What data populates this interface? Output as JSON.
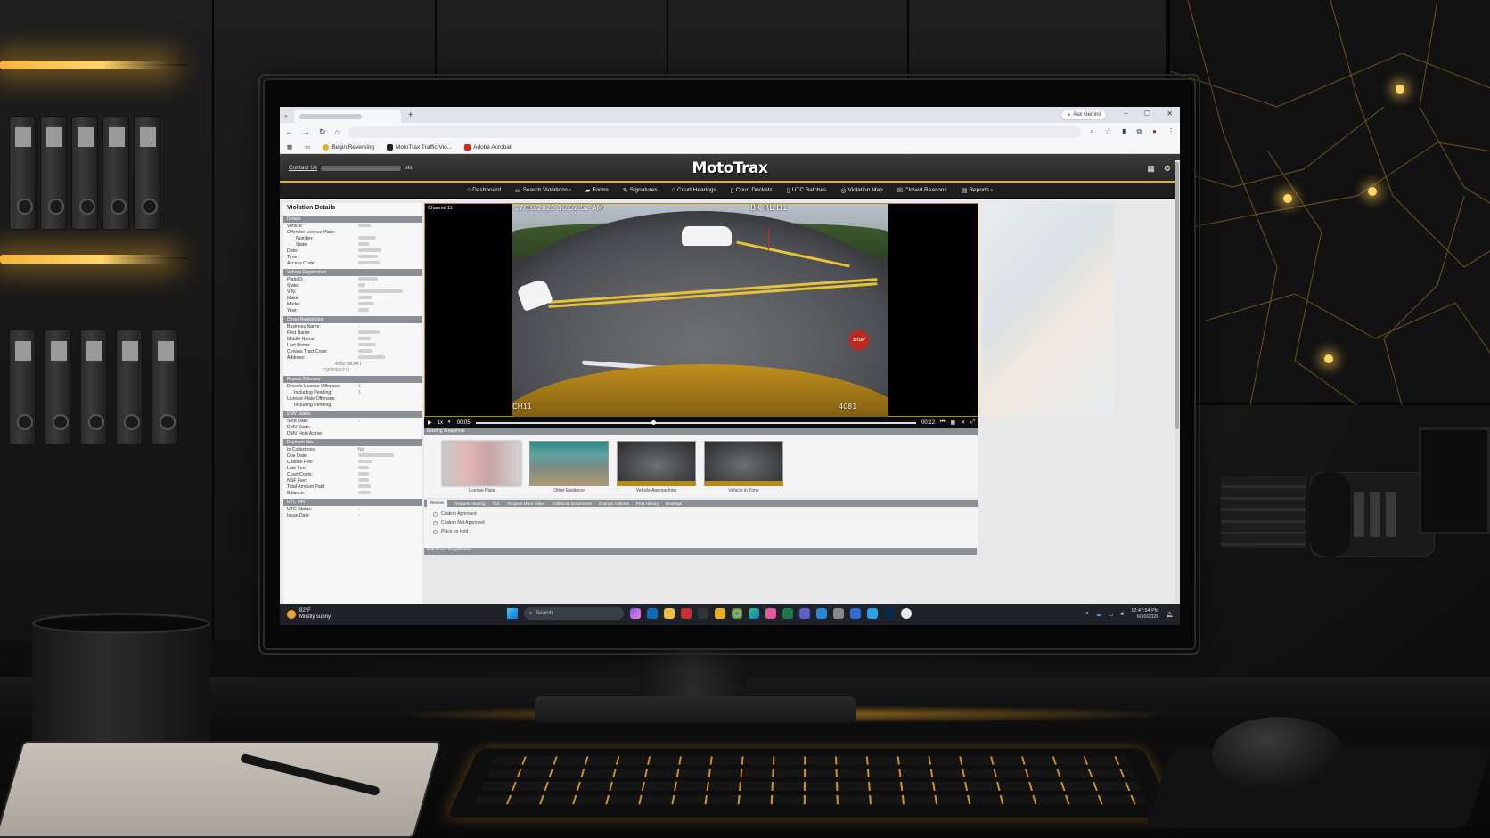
{
  "browser": {
    "new_tab_label": "+",
    "gemini_label": "Ask Gemini",
    "bookmarks": [
      {
        "label": "Begin Reversing",
        "color": "#e8b020"
      },
      {
        "label": "MotoTrax Traffic Vio...",
        "color": "#222222"
      },
      {
        "label": "Adobe Acrobat",
        "color": "#d4281f"
      }
    ]
  },
  "app": {
    "contact_label": "Contact Us",
    "contact_suffix": "ols",
    "logo": "MotoTrax",
    "accent_color": "#e3ad1f",
    "nav": [
      {
        "label": "Dashboard",
        "icon": "home-icon"
      },
      {
        "label": "Search Violations ›",
        "icon": "search-icon"
      },
      {
        "label": "Forms",
        "icon": "folder-icon"
      },
      {
        "label": "Signatures",
        "icon": "signature-icon"
      },
      {
        "label": "Court Hearings",
        "icon": "court-icon"
      },
      {
        "label": "Court Dockets",
        "icon": "docket-icon"
      },
      {
        "label": "UTC Batches",
        "icon": "batch-icon"
      },
      {
        "label": "Violation Map",
        "icon": "map-icon"
      },
      {
        "label": "Closed Reasons",
        "icon": "close-box-icon"
      },
      {
        "label": "Reports ›",
        "icon": "report-icon"
      }
    ]
  },
  "details": {
    "title": "Violation Details",
    "sections": [
      {
        "header": "Details",
        "rows": [
          "Vehicle:",
          "Offender License Plate:",
          "Number:",
          "State:",
          "Date:",
          "Time:",
          "Access Code:"
        ]
      },
      {
        "header": "Vehicle Registration",
        "rows": [
          "PlateID:",
          "State:",
          "VIN:",
          "Make:",
          "Model:",
          "Year:"
        ]
      },
      {
        "header": "Driver Registration",
        "rows": [
          "Business Name:",
          "First Name:",
          "Middle Name:",
          "Last Name:",
          "Census Tract Code:",
          "Address:"
        ]
      },
      {
        "header": "Repeat Offenses",
        "rows": [
          "Driver's License Offenses:",
          "Including Pending:",
          "License Plate Offenses:",
          "Including Pending:"
        ]
      },
      {
        "header": "DMV Status",
        "rows": [
          "Sent Date:",
          "DMV State:",
          "DMV Hold Active:"
        ]
      },
      {
        "header": "Payment Info",
        "rows": [
          "In Collections:",
          "Due Date:",
          "Citation Fee:",
          "Late Fee:",
          "Court Costs:",
          "NSF Fee:",
          "Total Amount Paid:",
          "Balance:"
        ]
      },
      {
        "header": "UTC Info",
        "rows": [
          "UTC Status:",
          "Issue Date:"
        ]
      }
    ],
    "repeat_values": [
      "1",
      "1"
    ],
    "collections_value": "No",
    "address_line1": "4950 INDIA I",
    "address_line2": "FORREST H"
  },
  "video": {
    "channel_label": "Channel 11",
    "osd_timestamp": "07/16/2025 16:52:52 AM",
    "osd_camera": "BK RL D1",
    "osd_channel": "CH11",
    "osd_unit": "4081",
    "stop_sign": "STOP",
    "speed": "1x",
    "time_current": "00:05",
    "time_total": "00:12",
    "progress_fraction": 0.4
  },
  "snapshots": {
    "header": "Existing Snapshots",
    "items": [
      {
        "label": "License Plate"
      },
      {
        "label": "Other Evidence"
      },
      {
        "label": "Vehicle Approaching"
      },
      {
        "label": "Vehicle in Zone"
      }
    ]
  },
  "action_tabs": [
    "Review",
    "Request Hearing",
    "TOL",
    "Request More Video",
    "Additional Documents",
    "Change Address",
    "Print History",
    "Hearings"
  ],
  "review": {
    "options": [
      "Citation Approved",
      "Citation Not Approved",
      "Place on hold"
    ]
  },
  "edit_bar": "Edit Driver Registration  ›",
  "taskbar": {
    "temperature": "82°F",
    "condition": "Mostly sunny",
    "search_placeholder": "Search",
    "time": "12:47:54 PM",
    "date": "6/10/2026"
  }
}
